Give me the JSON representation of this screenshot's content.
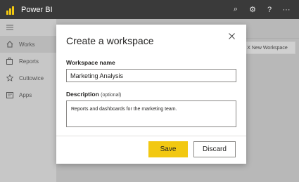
{
  "app": {
    "title": "Power BI",
    "brand_color": "#F2C811"
  },
  "topbar": {
    "icons": [
      {
        "name": "search-icon",
        "glyph": "⌕"
      },
      {
        "name": "gear-icon",
        "glyph": "⚙"
      },
      {
        "name": "help-icon",
        "glyph": "?"
      },
      {
        "name": "more-icon",
        "glyph": "···"
      }
    ]
  },
  "sidebar": {
    "items": [
      {
        "label": "",
        "icon": "hamburger-icon"
      },
      {
        "label": "Works",
        "icon": "home-icon"
      },
      {
        "label": "Reports",
        "icon": "report-icon"
      },
      {
        "label": "Cuttowice",
        "icon": "star-icon"
      },
      {
        "label": "Apps",
        "icon": "apps-icon"
      }
    ]
  },
  "background": {
    "new_workspace_label": "X New Workspace"
  },
  "dialog": {
    "title": "Create a workspace",
    "close_glyph": "×",
    "name_label": "Workspace name",
    "name_value": "Marketing Analysis",
    "description_label": "Description",
    "description_optional": "(optional)",
    "description_value": "Reports and dashboards for the marketing team.",
    "save_label": "Save",
    "discard_label": "Discard"
  }
}
